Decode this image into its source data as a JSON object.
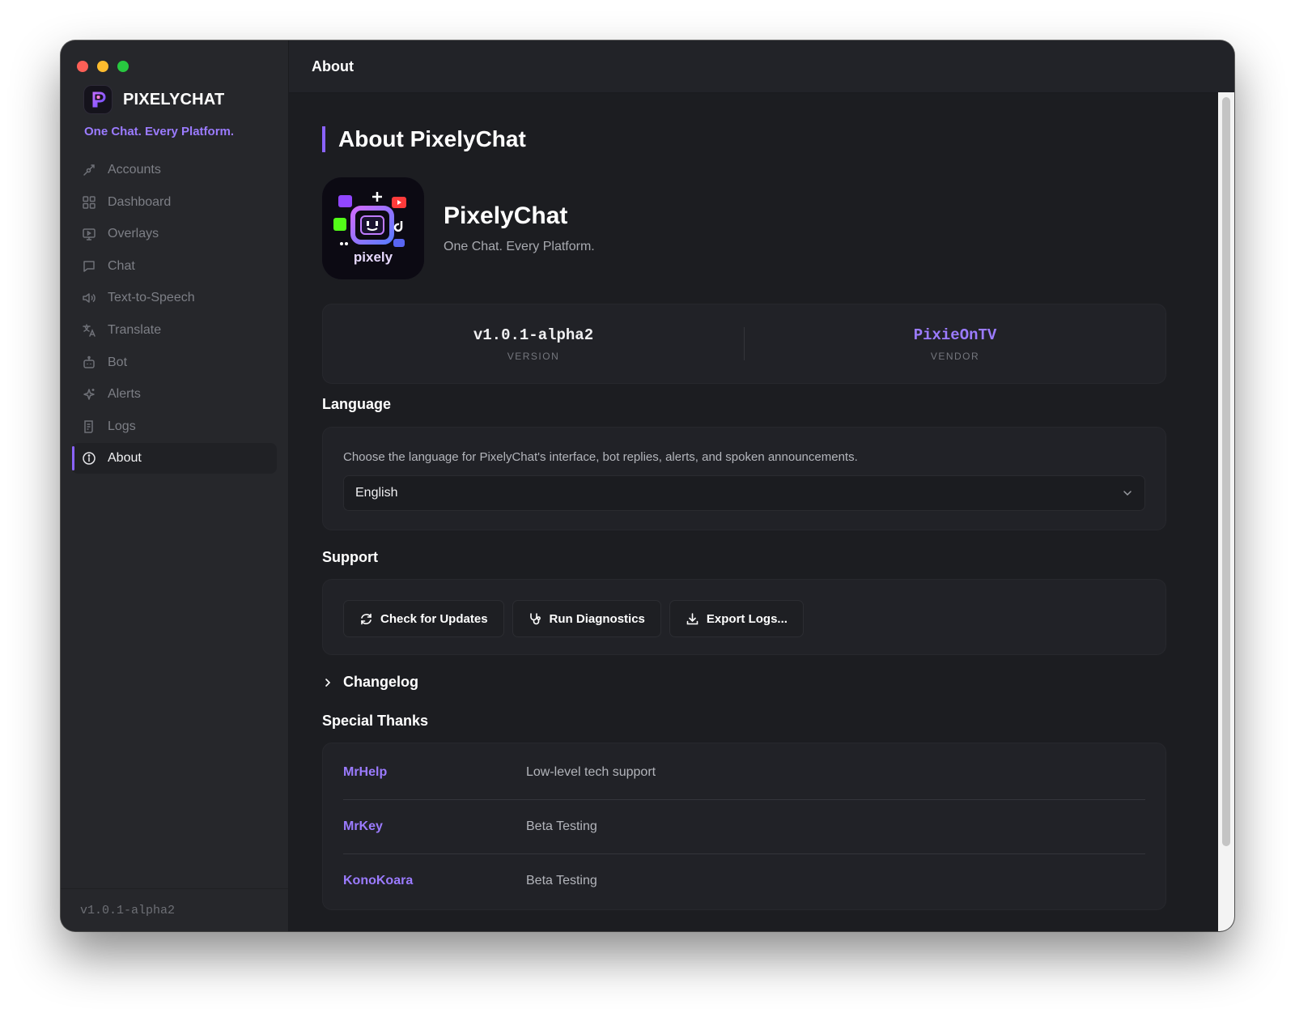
{
  "window": {
    "title": "About"
  },
  "sidebar": {
    "brand": "PIXELYCHAT",
    "tagline": "One Chat. Every Platform.",
    "items": [
      {
        "label": "Accounts",
        "icon": "accounts-icon"
      },
      {
        "label": "Dashboard",
        "icon": "dashboard-icon"
      },
      {
        "label": "Overlays",
        "icon": "overlays-icon"
      },
      {
        "label": "Chat",
        "icon": "chat-icon"
      },
      {
        "label": "Text-to-Speech",
        "icon": "speaker-icon"
      },
      {
        "label": "Translate",
        "icon": "translate-icon"
      },
      {
        "label": "Bot",
        "icon": "bot-icon"
      },
      {
        "label": "Alerts",
        "icon": "sparkle-icon"
      },
      {
        "label": "Logs",
        "icon": "logs-icon"
      },
      {
        "label": "About",
        "icon": "info-icon",
        "active": true
      }
    ],
    "version": "v1.0.1-alpha2"
  },
  "page": {
    "title": "About PixelyChat",
    "app_name": "PixelyChat",
    "app_subtitle": "One Chat. Every Platform.",
    "logo_text": "pixely"
  },
  "meta": {
    "version_value": "v1.0.1-alpha2",
    "version_label": "VERSION",
    "vendor_value": "PixieOnTV",
    "vendor_label": "VENDOR"
  },
  "language": {
    "heading": "Language",
    "description": "Choose the language for PixelyChat's interface, bot replies, alerts, and spoken announcements.",
    "selected": "English"
  },
  "support": {
    "heading": "Support",
    "buttons": [
      {
        "label": "Check for Updates",
        "icon": "refresh-icon"
      },
      {
        "label": "Run Diagnostics",
        "icon": "stethoscope-icon"
      },
      {
        "label": "Export Logs...",
        "icon": "download-icon"
      }
    ]
  },
  "changelog": {
    "label": "Changelog",
    "expanded": false
  },
  "thanks": {
    "heading": "Special Thanks",
    "rows": [
      {
        "name": "MrHelp",
        "role": "Low-level tech support"
      },
      {
        "name": "MrKey",
        "role": "Beta Testing"
      },
      {
        "name": "KonoKoara",
        "role": "Beta Testing"
      }
    ]
  },
  "colors": {
    "accent": "#8a63ff",
    "accent_text": "#9b7bff",
    "background": "#1c1d21",
    "sidebar": "#26272b"
  }
}
